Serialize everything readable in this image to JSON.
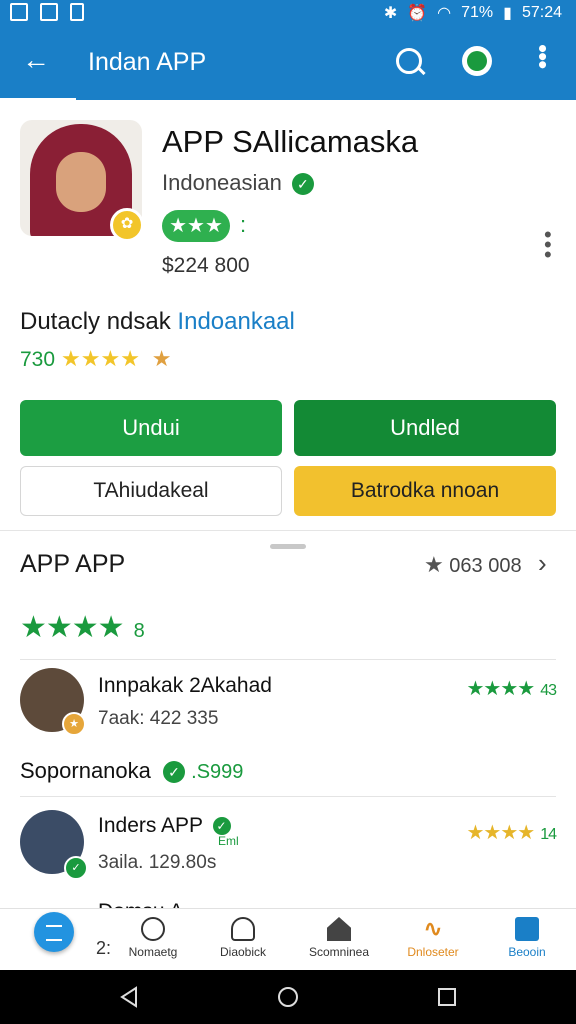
{
  "status": {
    "battery": "71%",
    "time": "57:24"
  },
  "appbar": {
    "title": "Indan APP",
    "back_icon": "arrow-left-icon",
    "search_icon": "search-icon",
    "account_icon": "account-icon",
    "more_icon": "more-vert-icon"
  },
  "app": {
    "name": "APP SAllicamaska",
    "developer": "Indoneasian",
    "rating_pill": "★★★",
    "price": "$224 800",
    "subtitle_main": "Dutacly ndsak",
    "subtitle_link": "Indoankaal",
    "score": "730",
    "score_stars": "★★★★",
    "score_extra": "★"
  },
  "buttons": {
    "primary_left": "Undui",
    "primary_right": "Undled",
    "secondary_left": "TAhiudakeal",
    "secondary_right": "Batrodka nnoan"
  },
  "reviews_section": {
    "title": "APP APP",
    "stat": "063 008",
    "stars": "★★★★",
    "count": "8"
  },
  "reviews": [
    {
      "name": "Innpakak 2Akahad",
      "meta": "7aak: 422 335",
      "stars": "★★★★",
      "count": "43"
    },
    {
      "name": "Inders APP",
      "meta": "3aila. 129.80s",
      "stars": "★★★★",
      "count": "14",
      "tag": "Eml"
    }
  ],
  "supporter": {
    "label": "Sopornanoka",
    "amount": ".S999"
  },
  "third_row": {
    "name": "Domsu A...",
    "meta": "2:"
  },
  "bottom_nav": [
    {
      "label": "Nomaetg",
      "icon": "clock-icon"
    },
    {
      "label": "Diaobick",
      "icon": "person-icon"
    },
    {
      "label": "Scomninea",
      "icon": "home-icon"
    },
    {
      "label": "Dnloseter",
      "icon": "wave-icon"
    },
    {
      "label": "Beooin",
      "icon": "document-icon"
    }
  ],
  "colors": {
    "primary": "#1a7fc7",
    "green": "#1c9e42",
    "yellow": "#f2c12e"
  }
}
